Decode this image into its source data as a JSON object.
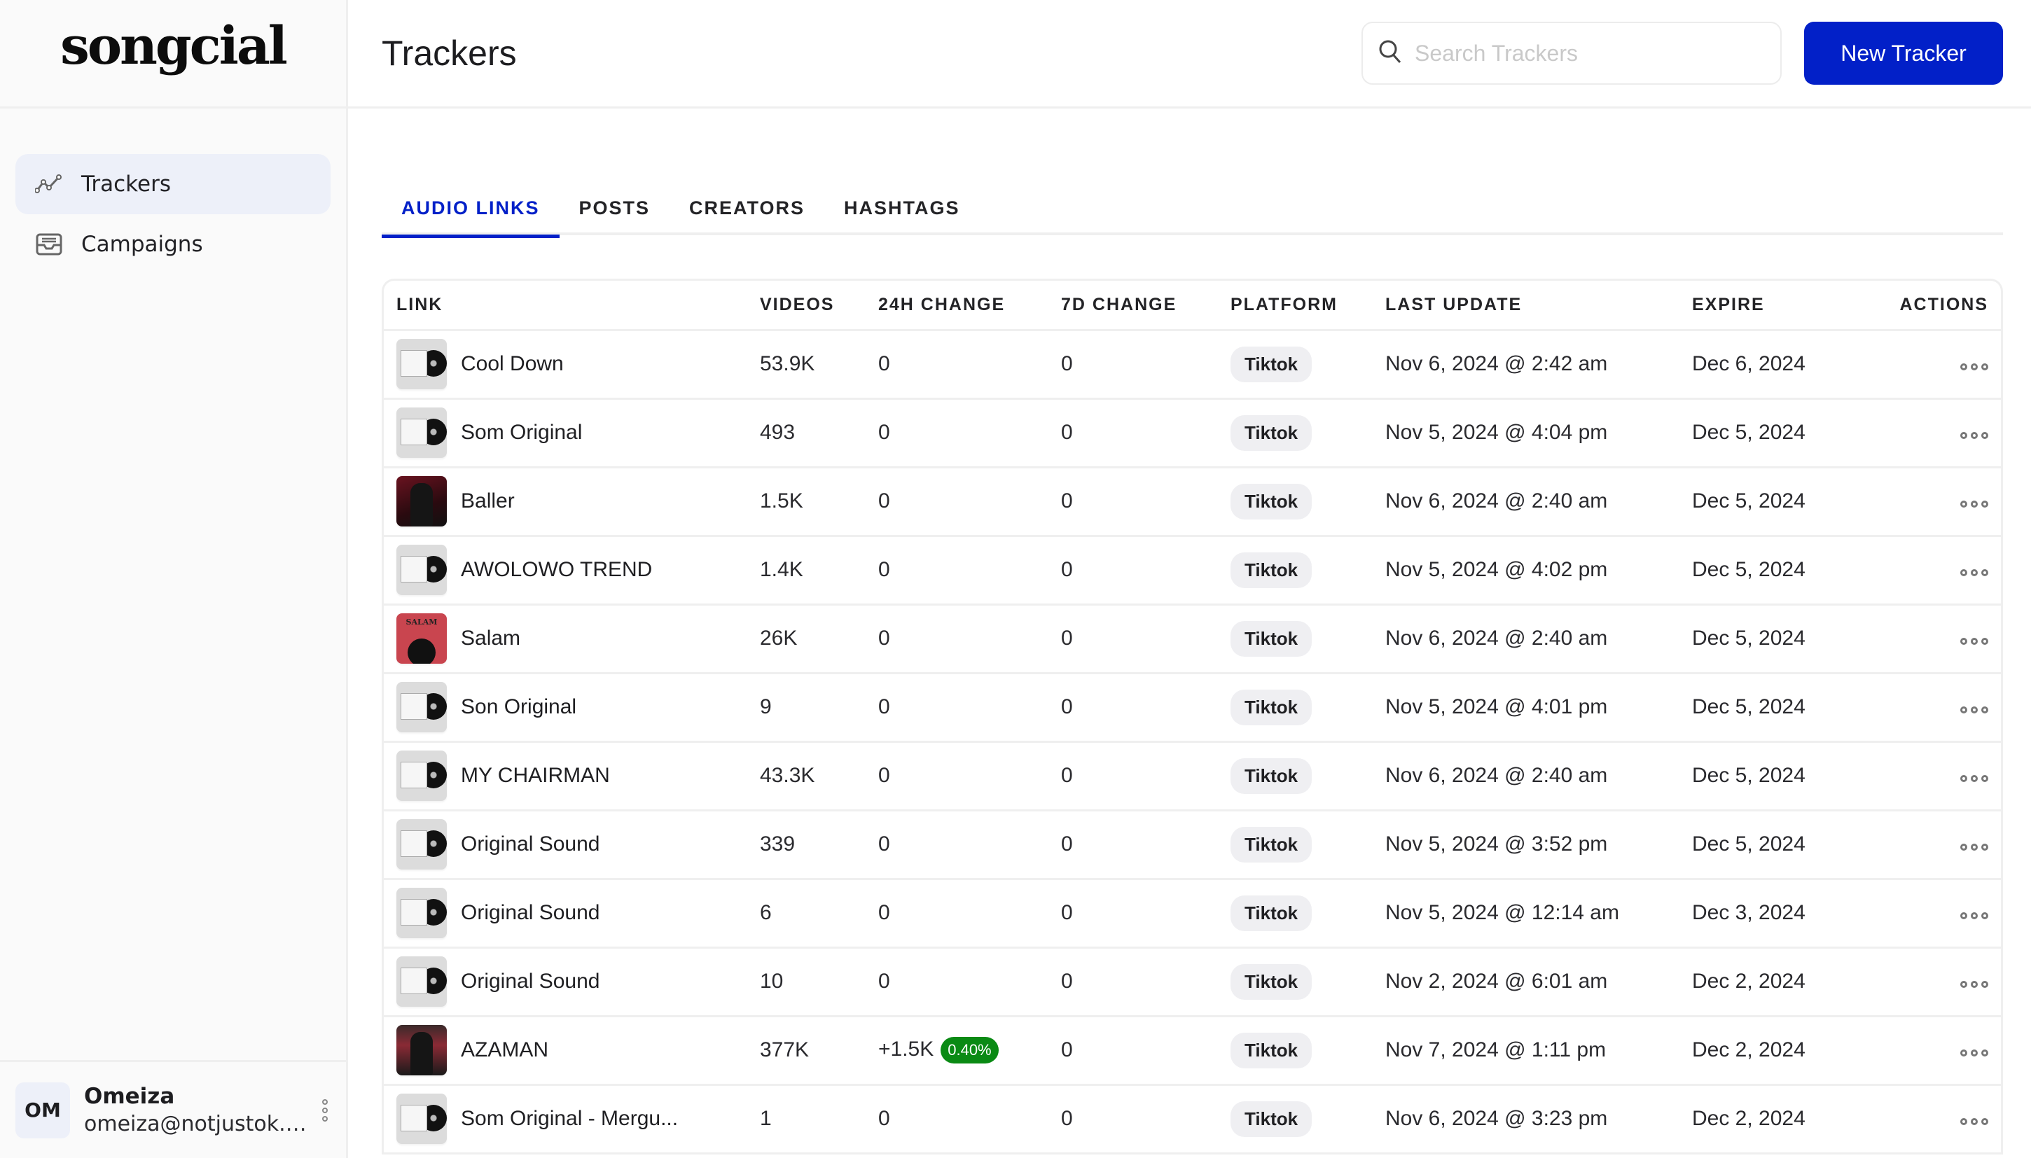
{
  "app": {
    "logo": "songcial"
  },
  "sidebar": {
    "items": [
      {
        "label": "Trackers",
        "icon": "trend-line-icon",
        "active": true
      },
      {
        "label": "Campaigns",
        "icon": "inbox-tray-icon",
        "active": false
      }
    ],
    "user": {
      "initials": "OM",
      "name": "Omeiza",
      "email": "omeiza@notjustok.c..."
    }
  },
  "header": {
    "title": "Trackers",
    "search_placeholder": "Search Trackers",
    "new_button": "New Tracker"
  },
  "tabs": [
    {
      "label": "AUDIO LINKS",
      "active": true
    },
    {
      "label": "POSTS",
      "active": false
    },
    {
      "label": "CREATORS",
      "active": false
    },
    {
      "label": "HASHTAGS",
      "active": false
    }
  ],
  "table": {
    "columns": [
      "LINK",
      "VIDEOS",
      "24H CHANGE",
      "7D CHANGE",
      "PLATFORM",
      "LAST UPDATE",
      "EXPIRE",
      "ACTIONS"
    ],
    "rows": [
      {
        "name": "Cool Down",
        "thumb": "vinyl",
        "videos": "53.9K",
        "change24h": "0",
        "change24h_pct": null,
        "change7d": "0",
        "platform": "Tiktok",
        "last_update": "Nov 6, 2024 @ 2:42 am",
        "expire": "Dec 6, 2024"
      },
      {
        "name": "Som Original",
        "thumb": "vinyl",
        "videos": "493",
        "change24h": "0",
        "change24h_pct": null,
        "change7d": "0",
        "platform": "Tiktok",
        "last_update": "Nov 5, 2024 @ 4:04 pm",
        "expire": "Dec 5, 2024"
      },
      {
        "name": "Baller",
        "thumb": "baller",
        "videos": "1.5K",
        "change24h": "0",
        "change24h_pct": null,
        "change7d": "0",
        "platform": "Tiktok",
        "last_update": "Nov 6, 2024 @ 2:40 am",
        "expire": "Dec 5, 2024"
      },
      {
        "name": "AWOLOWO TREND",
        "thumb": "vinyl",
        "videos": "1.4K",
        "change24h": "0",
        "change24h_pct": null,
        "change7d": "0",
        "platform": "Tiktok",
        "last_update": "Nov 5, 2024 @ 4:02 pm",
        "expire": "Dec 5, 2024"
      },
      {
        "name": "Salam",
        "thumb": "salam",
        "videos": "26K",
        "change24h": "0",
        "change24h_pct": null,
        "change7d": "0",
        "platform": "Tiktok",
        "last_update": "Nov 6, 2024 @ 2:40 am",
        "expire": "Dec 5, 2024"
      },
      {
        "name": "Son Original",
        "thumb": "vinyl",
        "videos": "9",
        "change24h": "0",
        "change24h_pct": null,
        "change7d": "0",
        "platform": "Tiktok",
        "last_update": "Nov 5, 2024 @ 4:01 pm",
        "expire": "Dec 5, 2024"
      },
      {
        "name": "MY CHAIRMAN",
        "thumb": "vinyl",
        "videos": "43.3K",
        "change24h": "0",
        "change24h_pct": null,
        "change7d": "0",
        "platform": "Tiktok",
        "last_update": "Nov 6, 2024 @ 2:40 am",
        "expire": "Dec 5, 2024"
      },
      {
        "name": "Original Sound",
        "thumb": "vinyl",
        "videos": "339",
        "change24h": "0",
        "change24h_pct": null,
        "change7d": "0",
        "platform": "Tiktok",
        "last_update": "Nov 5, 2024 @ 3:52 pm",
        "expire": "Dec 5, 2024"
      },
      {
        "name": "Original Sound",
        "thumb": "vinyl",
        "videos": "6",
        "change24h": "0",
        "change24h_pct": null,
        "change7d": "0",
        "platform": "Tiktok",
        "last_update": "Nov 5, 2024 @ 12:14 am",
        "expire": "Dec 3, 2024"
      },
      {
        "name": "Original Sound",
        "thumb": "vinyl",
        "videos": "10",
        "change24h": "0",
        "change24h_pct": null,
        "change7d": "0",
        "platform": "Tiktok",
        "last_update": "Nov 2, 2024 @ 6:01 am",
        "expire": "Dec 2, 2024"
      },
      {
        "name": "AZAMAN",
        "thumb": "azaman",
        "videos": "377K",
        "change24h": "+1.5K",
        "change24h_pct": "0.40%",
        "change7d": "0",
        "platform": "Tiktok",
        "last_update": "Nov 7, 2024 @ 1:11 pm",
        "expire": "Dec 2, 2024"
      },
      {
        "name": "Som Original - Mergu...",
        "thumb": "vinyl",
        "videos": "1",
        "change24h": "0",
        "change24h_pct": null,
        "change7d": "0",
        "platform": "Tiktok",
        "last_update": "Nov 6, 2024 @ 3:23 pm",
        "expire": "Dec 2, 2024"
      }
    ]
  },
  "colors": {
    "accent": "#0220c8",
    "positive": "#0a8a14",
    "active_nav_bg": "#edf0f9"
  }
}
